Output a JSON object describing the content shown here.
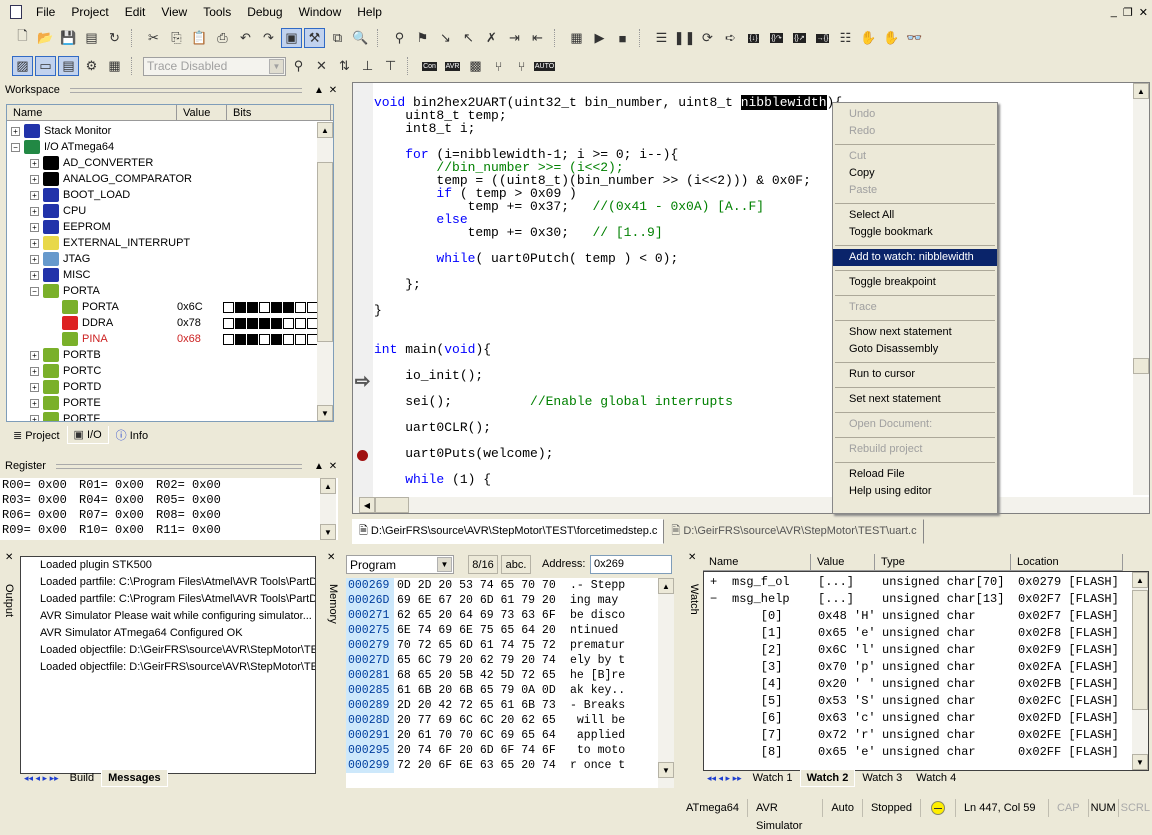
{
  "menu": [
    "File",
    "Project",
    "Edit",
    "View",
    "Tools",
    "Debug",
    "Window",
    "Help"
  ],
  "window_controls": [
    "_",
    "❐",
    "✕"
  ],
  "toolbar1": [
    {
      "icon": "new-file-icon",
      "g": "🗋"
    },
    {
      "icon": "open-folder-icon",
      "g": "📂"
    },
    {
      "icon": "save-icon",
      "g": "💾"
    },
    {
      "icon": "save-all-icon",
      "g": "▤"
    },
    {
      "icon": "refresh-icon",
      "g": "↻"
    },
    {
      "icon": "sep"
    },
    {
      "icon": "cut-icon",
      "g": "✂"
    },
    {
      "icon": "copy-icon",
      "g": "⎘"
    },
    {
      "icon": "paste-icon",
      "g": "📋"
    },
    {
      "icon": "print-icon",
      "g": "⎙"
    },
    {
      "icon": "undo-icon",
      "g": "↶"
    },
    {
      "icon": "redo-icon",
      "g": "↷"
    },
    {
      "icon": "workspace-toggle-icon",
      "g": "▣",
      "on": true
    },
    {
      "icon": "build-icon",
      "g": "⚒",
      "on": true
    },
    {
      "icon": "windows-icon",
      "g": "⧉"
    },
    {
      "icon": "find-in-files-icon",
      "g": "🔍"
    },
    {
      "icon": "sep"
    },
    {
      "icon": "find-icon",
      "g": "⚲"
    },
    {
      "icon": "toggle-bookmark-icon",
      "g": "⚑"
    },
    {
      "icon": "next-bookmark-icon",
      "g": "↘"
    },
    {
      "icon": "prev-bookmark-icon",
      "g": "↖"
    },
    {
      "icon": "clear-bookmarks-icon",
      "g": "✗"
    },
    {
      "icon": "indent-icon",
      "g": "⇥"
    },
    {
      "icon": "outdent-icon",
      "g": "⇤"
    },
    {
      "icon": "sep"
    },
    {
      "icon": "debug-start-icon",
      "g": "▦"
    },
    {
      "icon": "run-icon",
      "g": "▶"
    },
    {
      "icon": "stop-icon",
      "g": "■"
    },
    {
      "icon": "sep"
    },
    {
      "icon": "reset-icon",
      "g": "☰"
    },
    {
      "icon": "break-icon",
      "g": "❚❚"
    },
    {
      "icon": "show-next-statement-icon",
      "g": "⟳"
    },
    {
      "icon": "next-statement-arrow-icon",
      "g": "➪"
    },
    {
      "icon": "step-into-icon",
      "g": "{↓}"
    },
    {
      "icon": "step-over-icon",
      "g": "{}↷"
    },
    {
      "icon": "step-out-icon",
      "g": "{}↗"
    },
    {
      "icon": "run-to-cursor-icon",
      "g": "→{}"
    },
    {
      "icon": "auto-step-icon",
      "g": "☷"
    },
    {
      "icon": "toggle-breakpoint-icon",
      "g": "✋"
    },
    {
      "icon": "remove-breakpoints-icon",
      "g": "✋"
    },
    {
      "icon": "quickwatch-icon",
      "g": "👓"
    }
  ],
  "toolbar2": {
    "left": [
      {
        "icon": "trace-view-icon",
        "g": "▨",
        "on": true
      },
      {
        "icon": "trace-control-icon",
        "g": "▭",
        "on": true
      },
      {
        "icon": "trace-list-icon",
        "g": "▤",
        "on": true
      },
      {
        "icon": "trace-settings-icon",
        "g": "⚙"
      },
      {
        "icon": "trace-log-icon",
        "g": "▦"
      }
    ],
    "trace_select": "Trace Disabled",
    "right": [
      {
        "icon": "trace-point-icon",
        "g": "⚲"
      },
      {
        "icon": "clear-trace-icon",
        "g": "✕"
      },
      {
        "icon": "trace-step-icon",
        "g": "⇅"
      },
      {
        "icon": "trace-start-icon",
        "g": "⊥"
      },
      {
        "icon": "trace-stop-icon",
        "g": "⊤"
      },
      {
        "icon": "sep"
      },
      {
        "icon": "con-icon",
        "g": "Con"
      },
      {
        "icon": "avr-icon",
        "g": "AVR"
      },
      {
        "icon": "chip-icon",
        "g": "▩"
      },
      {
        "icon": "branch-icon",
        "g": "⑂"
      },
      {
        "icon": "branch2-icon",
        "g": "⑂"
      },
      {
        "icon": "auto-icon",
        "g": "AUTO"
      }
    ]
  },
  "workspace": {
    "title": "Workspace",
    "columns": [
      "Name",
      "Value",
      "Bits"
    ],
    "rows": [
      {
        "label": "Stack Monitor",
        "level": 0,
        "exp": "+",
        "icon": "document-icon",
        "color": "#2233aa"
      },
      {
        "label": "I/O ATmega64",
        "level": 0,
        "exp": "−",
        "icon": "traffic-light-icon",
        "color": "#228844"
      },
      {
        "label": "AD_CONVERTER",
        "level": 1,
        "exp": "+",
        "icon": "and-gate-icon",
        "color": "#000"
      },
      {
        "label": "ANALOG_COMPARATOR",
        "level": 1,
        "exp": "+",
        "icon": "and-gate-icon",
        "color": "#000"
      },
      {
        "label": "BOOT_LOAD",
        "level": 1,
        "exp": "+",
        "icon": "document-icon",
        "color": "#2233aa"
      },
      {
        "label": "CPU",
        "level": 1,
        "exp": "+",
        "icon": "document-icon",
        "color": "#2233aa"
      },
      {
        "label": "EEPROM",
        "level": 1,
        "exp": "+",
        "icon": "document-icon",
        "color": "#2233aa"
      },
      {
        "label": "EXTERNAL_INTERRUPT",
        "level": 1,
        "exp": "+",
        "icon": "bell-icon",
        "color": "#e8d84a"
      },
      {
        "label": "JTAG",
        "level": 1,
        "exp": "+",
        "icon": "jtag-icon",
        "color": "#6699cc"
      },
      {
        "label": "MISC",
        "level": 1,
        "exp": "+",
        "icon": "document-icon",
        "color": "#2233aa"
      },
      {
        "label": "PORTA",
        "level": 1,
        "exp": "−",
        "icon": "port-icon",
        "color": "#7ab02a"
      },
      {
        "label": "PORTA",
        "level": 2,
        "icon": "port-icon",
        "color": "#7ab02a",
        "value": "0x6C",
        "bits": [
          0,
          1,
          1,
          0,
          1,
          1,
          0,
          0
        ]
      },
      {
        "label": "DDRA",
        "level": 2,
        "icon": "flag-icon",
        "color": "#dd2222",
        "value": "0x78",
        "bits": [
          0,
          1,
          1,
          1,
          1,
          0,
          0,
          0
        ]
      },
      {
        "label": "PINA",
        "level": 2,
        "icon": "port-icon",
        "color": "#7ab02a",
        "value": "0x68",
        "bits": [
          0,
          1,
          1,
          0,
          1,
          0,
          0,
          0
        ],
        "changed": true
      },
      {
        "label": "PORTB",
        "level": 1,
        "exp": "+",
        "icon": "port-icon",
        "color": "#7ab02a"
      },
      {
        "label": "PORTC",
        "level": 1,
        "exp": "+",
        "icon": "port-icon",
        "color": "#7ab02a"
      },
      {
        "label": "PORTD",
        "level": 1,
        "exp": "+",
        "icon": "port-icon",
        "color": "#7ab02a"
      },
      {
        "label": "PORTE",
        "level": 1,
        "exp": "+",
        "icon": "port-icon",
        "color": "#7ab02a"
      },
      {
        "label": "PORTF",
        "level": 1,
        "exp": "+",
        "icon": "port-icon",
        "color": "#7ab02a"
      }
    ],
    "tabs": [
      "Project",
      "I/O",
      "Info"
    ],
    "active_tab": "I/O",
    "changed_color": "#cc2222"
  },
  "register": {
    "title": "Register",
    "rows": [
      [
        "R00= 0x00",
        "R01= 0x00",
        "R02= 0x00"
      ],
      [
        "R03= 0x00",
        "R04= 0x00",
        "R05= 0x00"
      ],
      [
        "R06= 0x00",
        "R07= 0x00",
        "R08= 0x00"
      ],
      [
        "R09= 0x00",
        "R10= 0x00",
        "R11= 0x00"
      ]
    ]
  },
  "editor": {
    "lines": [
      [
        [
          "void",
          "kw"
        ],
        [
          " bin2hex2UART(uint32_t bin_number, uint8_t "
        ],
        [
          "nibblewidth",
          "sel-word"
        ],
        [
          "){"
        ]
      ],
      [
        [
          "    uint8_t temp;"
        ]
      ],
      [
        [
          "    int8_t i;"
        ]
      ],
      [],
      [
        [
          "    "
        ],
        [
          "for",
          "kw"
        ],
        [
          " (i=nibblewidth-1; i >= 0; i--){"
        ]
      ],
      [
        [
          "        "
        ],
        [
          "//bin_number >>= (i<<2);",
          "cm"
        ]
      ],
      [
        [
          "        temp = ((uint8_t)(bin_number >> (i<<2))) & 0x0F;"
        ]
      ],
      [
        [
          "        "
        ],
        [
          "if",
          "kw"
        ],
        [
          " ( temp > 0x09 )"
        ]
      ],
      [
        [
          "            temp += 0x37;   "
        ],
        [
          "//(0x41 - 0x0A) [A..F]",
          "cm"
        ]
      ],
      [
        [
          "        "
        ],
        [
          "else",
          "kw"
        ]
      ],
      [
        [
          "            temp += 0x30;   "
        ],
        [
          "// [1..9]",
          "cm"
        ]
      ],
      [],
      [
        [
          "        "
        ],
        [
          "while",
          "kw"
        ],
        [
          "( uart0Putch( temp ) < 0);"
        ]
      ],
      [],
      [
        [
          "    };"
        ]
      ],
      [],
      [
        [
          "}"
        ]
      ],
      [],
      [],
      [
        [
          "int",
          "kw"
        ],
        [
          " main("
        ],
        [
          "void",
          "kw"
        ],
        [
          "){"
        ]
      ],
      [],
      [
        [
          "    io_init();"
        ]
      ],
      [],
      [
        [
          "    sei();          "
        ],
        [
          "//Enable global interrupts",
          "cm"
        ]
      ],
      [],
      [
        [
          "    uart0CLR();"
        ]
      ],
      [],
      [
        [
          "    uart0Puts(welcome);"
        ]
      ],
      [],
      [
        [
          "    "
        ],
        [
          "while",
          "kw"
        ],
        [
          " (1) {"
        ]
      ]
    ],
    "doc_tabs": [
      "D:\\GeirFRS\\source\\AVR\\StepMotor\\TEST\\forcetimedstep.c",
      "D:\\GeirFRS\\source\\AVR\\StepMotor\\TEST\\uart.c"
    ]
  },
  "context_menu": [
    {
      "label": "Undo",
      "disabled": true
    },
    {
      "label": "Redo",
      "disabled": true
    },
    {
      "sep": true
    },
    {
      "label": "Cut",
      "disabled": true
    },
    {
      "label": "Copy"
    },
    {
      "label": "Paste",
      "disabled": true
    },
    {
      "sep": true
    },
    {
      "label": "Select All"
    },
    {
      "label": "Toggle bookmark"
    },
    {
      "sep": true
    },
    {
      "label": "Add to watch: nibblewidth",
      "highlight": true
    },
    {
      "sep": true
    },
    {
      "label": "Toggle breakpoint"
    },
    {
      "sep": true
    },
    {
      "label": "Trace",
      "disabled": true
    },
    {
      "sep": true
    },
    {
      "label": "Show next statement"
    },
    {
      "label": "Goto Disassembly"
    },
    {
      "sep": true
    },
    {
      "label": "Run to cursor"
    },
    {
      "sep": true
    },
    {
      "label": "Set next statement"
    },
    {
      "sep": true
    },
    {
      "label": "Open Document:",
      "disabled": true
    },
    {
      "sep": true
    },
    {
      "label": "Rebuild project",
      "disabled": true
    },
    {
      "sep": true
    },
    {
      "label": "Reload File"
    },
    {
      "label": "Help using editor"
    }
  ],
  "output": {
    "title": "Output",
    "lines": [
      "Loaded plugin STK500",
      "Loaded partfile: C:\\Program Files\\Atmel\\AVR Tools\\PartDe",
      "Loaded partfile: C:\\Program Files\\Atmel\\AVR Tools\\PartDe",
      "AVR Simulator Please wait while configuring simulator...",
      "AVR Simulator ATmega64 Configured OK",
      "Loaded objectfile: D:\\GeirFRS\\source\\AVR\\StepMotor\\TES",
      "Loaded objectfile: D:\\GeirFRS\\source\\AVR\\StepMotor\\TES"
    ],
    "tabs": [
      "Build",
      "Messages"
    ],
    "active_tab": "Messages"
  },
  "memory": {
    "title": "Memory",
    "type": "Program",
    "btn_width": "8/16",
    "btn_ascii": "abc.",
    "address_label": "Address:",
    "address": "0x269",
    "rows": [
      [
        "000269",
        "0D 2D 20 53 74 65 70 70",
        ".- Stepp"
      ],
      [
        "00026D",
        "69 6E 67 20 6D 61 79 20",
        "ing may "
      ],
      [
        "000271",
        "62 65 20 64 69 73 63 6F",
        "be disco"
      ],
      [
        "000275",
        "6E 74 69 6E 75 65 64 20",
        "ntinued "
      ],
      [
        "000279",
        "70 72 65 6D 61 74 75 72",
        "prematur"
      ],
      [
        "00027D",
        "65 6C 79 20 62 79 20 74",
        "ely by t"
      ],
      [
        "000281",
        "68 65 20 5B 42 5D 72 65",
        "he [B]re"
      ],
      [
        "000285",
        "61 6B 20 6B 65 79 0A 0D",
        "ak key.."
      ],
      [
        "000289",
        "2D 20 42 72 65 61 6B 73",
        "- Breaks"
      ],
      [
        "00028D",
        "20 77 69 6C 6C 20 62 65",
        " will be"
      ],
      [
        "000291",
        "20 61 70 70 6C 69 65 64",
        " applied"
      ],
      [
        "000295",
        "20 74 6F 20 6D 6F 74 6F",
        " to moto"
      ],
      [
        "000299",
        "72 20 6F 6E 63 65 20 74",
        "r once t"
      ]
    ]
  },
  "watch": {
    "title": "Watch",
    "columns": [
      "Name",
      "Value",
      "Type",
      "Location"
    ],
    "rows": [
      [
        "+",
        "msg_f_ol",
        "[...]",
        "unsigned char[70]",
        "0x0279 [FLASH]"
      ],
      [
        "−",
        "msg_help",
        "[...]",
        "unsigned char[13]",
        "0x02F7 [FLASH]"
      ],
      [
        "",
        "    [0]",
        "0x48 'H'",
        "unsigned char",
        "0x02F7 [FLASH]"
      ],
      [
        "",
        "    [1]",
        "0x65 'e'",
        "unsigned char",
        "0x02F8 [FLASH]"
      ],
      [
        "",
        "    [2]",
        "0x6C 'l'",
        "unsigned char",
        "0x02F9 [FLASH]"
      ],
      [
        "",
        "    [3]",
        "0x70 'p'",
        "unsigned char",
        "0x02FA [FLASH]"
      ],
      [
        "",
        "    [4]",
        "0x20 ' '",
        "unsigned char",
        "0x02FB [FLASH]"
      ],
      [
        "",
        "    [5]",
        "0x53 'S'",
        "unsigned char",
        "0x02FC [FLASH]"
      ],
      [
        "",
        "    [6]",
        "0x63 'c'",
        "unsigned char",
        "0x02FD [FLASH]"
      ],
      [
        "",
        "    [7]",
        "0x72 'r'",
        "unsigned char",
        "0x02FE [FLASH]"
      ],
      [
        "",
        "    [8]",
        "0x65 'e'",
        "unsigned char",
        "0x02FF [FLASH]"
      ]
    ],
    "tabs": [
      "Watch 1",
      "Watch 2",
      "Watch 3",
      "Watch 4"
    ],
    "active_tab": "Watch 2"
  },
  "status": {
    "device": "ATmega64",
    "platform": "AVR Simulator",
    "mode": "Auto",
    "state": "Stopped",
    "position": "Ln 447, Col 59",
    "cap": "CAP",
    "num": "NUM",
    "scrl": "SCRL",
    "state_color": "#ffee00"
  }
}
